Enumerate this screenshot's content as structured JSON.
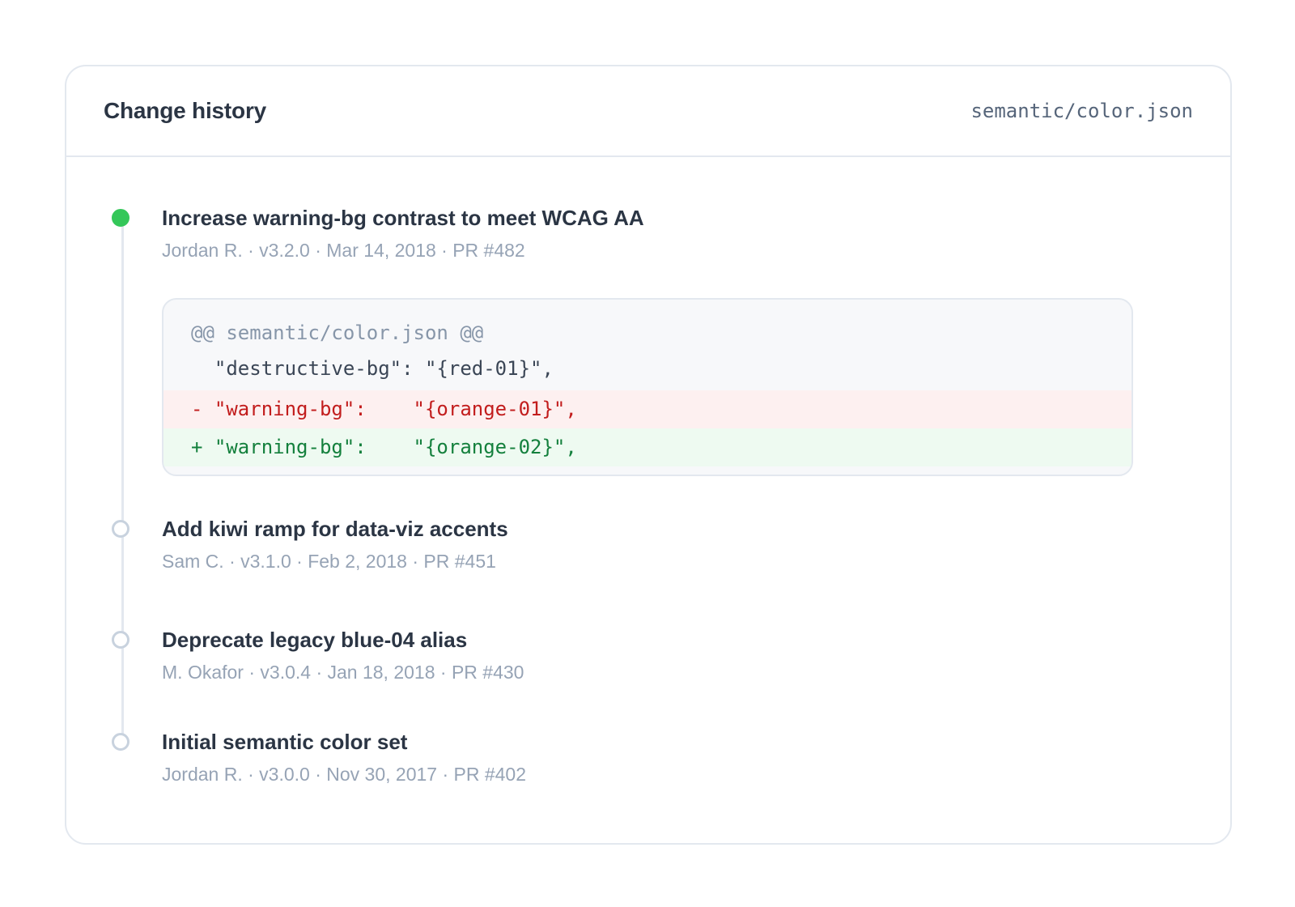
{
  "header": {
    "title": "Change history",
    "file_path": "semantic/color.json"
  },
  "entries": [
    {
      "title": "Increase warning-bg contrast to meet WCAG AA",
      "meta": "Jordan R. · v3.2.0 · Mar 14, 2018 · PR #482",
      "status": "current",
      "diff": {
        "hunk": "@@ semantic/color.json @@",
        "context": "  \"destructive-bg\": \"{red-01}\",",
        "removed": "- \"warning-bg\":    \"{orange-01}\",",
        "added": "+ \"warning-bg\":    \"{orange-02}\","
      }
    },
    {
      "title": "Add kiwi ramp for data-viz accents",
      "meta": "Sam C. · v3.1.0 · Feb 2, 2018 · PR #451",
      "status": "past"
    },
    {
      "title": "Deprecate legacy blue-04 alias",
      "meta": "M. Okafor · v3.0.4 · Jan 18, 2018 · PR #430",
      "status": "past"
    },
    {
      "title": "Initial semantic color set",
      "meta": "Jordan R. · v3.0.0 · Nov 30, 2017 · PR #402",
      "status": "past"
    }
  ],
  "colors": {
    "active_dot": "#34c759",
    "inactive_dot_border": "#c8d2de",
    "removed_text": "#c21d1d",
    "removed_bg": "#fdf0f0",
    "added_text": "#14803d",
    "added_bg": "#eefaf1"
  }
}
